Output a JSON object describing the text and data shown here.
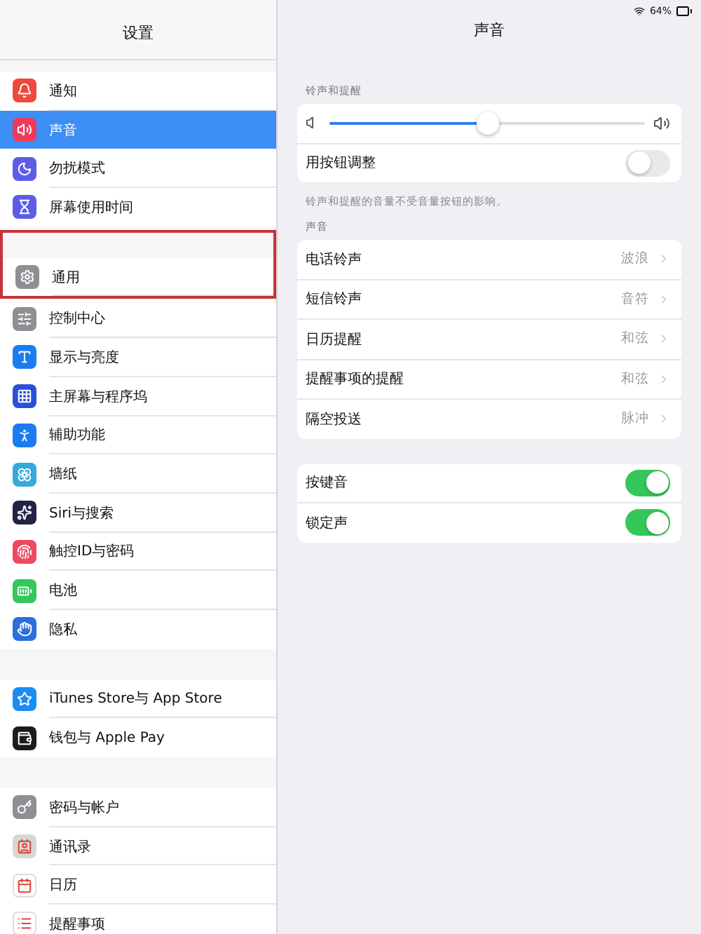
{
  "sidebar": {
    "title": "设置",
    "groups": [
      {
        "items": [
          {
            "label": "通知",
            "color": "#f0483e",
            "selected": false,
            "highlighted": false
          },
          {
            "label": "声音",
            "color": "#f03a5a",
            "selected": true,
            "highlighted": false
          },
          {
            "label": "勿扰模式",
            "color": "#5d5ce6",
            "selected": false,
            "highlighted": false
          },
          {
            "label": "屏幕使用时间",
            "color": "#5d5ce6",
            "selected": false,
            "highlighted": false
          }
        ]
      },
      {
        "items": [
          {
            "label": "通用",
            "color": "#8e8e93",
            "selected": false,
            "highlighted": true
          },
          {
            "label": "控制中心",
            "color": "#8e8e93",
            "selected": false,
            "highlighted": false
          },
          {
            "label": "显示与亮度",
            "color": "#1a7cf0",
            "selected": false,
            "highlighted": false
          },
          {
            "label": "主屏幕与程序坞",
            "color": "#2b4fd8",
            "selected": false,
            "highlighted": false
          },
          {
            "label": "辅助功能",
            "color": "#1a7cf0",
            "selected": false,
            "highlighted": false
          },
          {
            "label": "墙纸",
            "color": "#35aadc",
            "selected": false,
            "highlighted": false
          },
          {
            "label": "Siri与搜索",
            "color": "#222244",
            "selected": false,
            "highlighted": false
          },
          {
            "label": "触控ID与密码",
            "color": "#f0485e",
            "selected": false,
            "highlighted": false
          },
          {
            "label": "电池",
            "color": "#34c759",
            "selected": false,
            "highlighted": false
          },
          {
            "label": "隐私",
            "color": "#2a6fdb",
            "selected": false,
            "highlighted": false
          }
        ]
      },
      {
        "items": [
          {
            "label": "iTunes Store与 App Store",
            "color": "#1a8cf5",
            "selected": false,
            "highlighted": false
          },
          {
            "label": "钱包与 Apple Pay",
            "color": "#1c1c1e",
            "selected": false,
            "highlighted": false
          }
        ]
      },
      {
        "items": [
          {
            "label": "密码与帐户",
            "color": "#8e8e93",
            "selected": false,
            "highlighted": false
          },
          {
            "label": "通讯录",
            "color": "#d8d8d2",
            "selected": false,
            "highlighted": false
          },
          {
            "label": "日历",
            "color": "#ffffff",
            "selected": false,
            "highlighted": false
          },
          {
            "label": "提醒事项",
            "color": "#ffffff",
            "selected": false,
            "highlighted": false
          }
        ]
      }
    ]
  },
  "status": {
    "battery": "64%"
  },
  "detail": {
    "title": "声音",
    "sections": [
      {
        "header": "铃声和提醒",
        "rows": [
          {
            "kind": "slider",
            "level": 0.5
          },
          {
            "kind": "toggle",
            "label": "用按钮调整",
            "on": false
          }
        ],
        "footer": "铃声和提醒的音量不受音量按钮的影响。"
      },
      {
        "header": "声音",
        "rows": [
          {
            "kind": "link",
            "label": "电话铃声",
            "value": "波浪"
          },
          {
            "kind": "link",
            "label": "短信铃声",
            "value": "音符"
          },
          {
            "kind": "link",
            "label": "日历提醒",
            "value": "和弦"
          },
          {
            "kind": "link",
            "label": "提醒事项的提醒",
            "value": "和弦"
          },
          {
            "kind": "link",
            "label": "隔空投送",
            "value": "脉冲"
          }
        ]
      },
      {
        "rows": [
          {
            "kind": "toggle",
            "label": "按键音",
            "on": true
          },
          {
            "kind": "toggle",
            "label": "锁定声",
            "on": true
          }
        ]
      }
    ]
  }
}
